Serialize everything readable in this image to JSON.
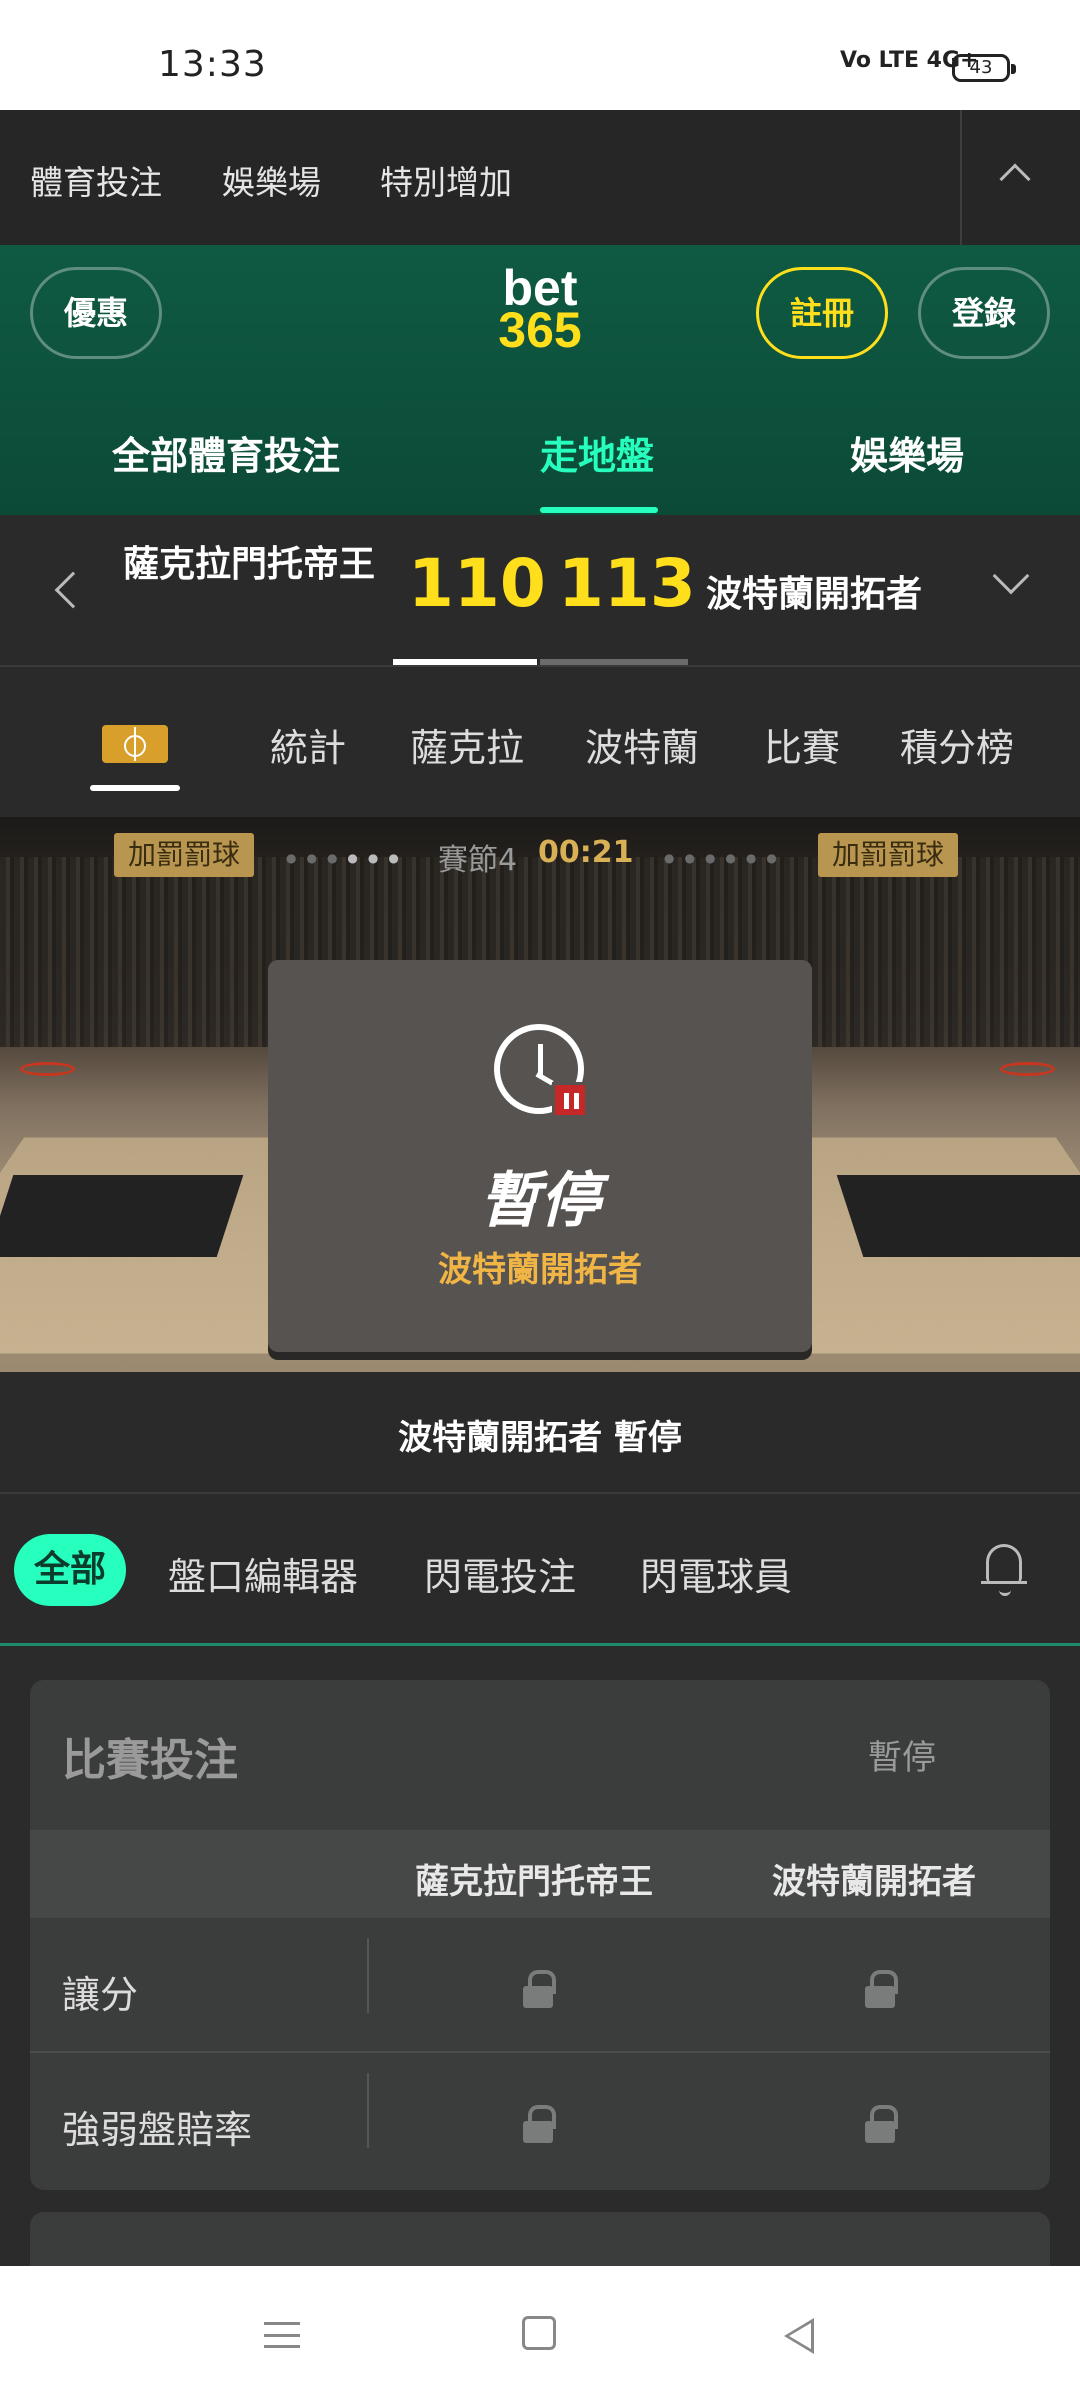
{
  "status_bar": {
    "time": "13:33",
    "signal": "Vo LTE 4G+",
    "battery": "43"
  },
  "top_nav": {
    "items": [
      "體育投注",
      "娛樂場",
      "特別增加"
    ]
  },
  "header": {
    "promo_button": "優惠",
    "logo_top": "bet",
    "logo_bottom": "365",
    "register_button": "註冊",
    "login_button": "登錄",
    "tabs": [
      "全部體育投注",
      "走地盤",
      "娛樂場"
    ],
    "active_tab": "走地盤",
    "accent_color": "#26ffbe",
    "brand_yellow": "#ffdf1b"
  },
  "scoreboard": {
    "home_team": "薩克拉門托帝王",
    "home_score": "110",
    "away_score": "113",
    "away_team": "波特蘭開拓者"
  },
  "sub_tabs": {
    "items": [
      "統計",
      "薩克拉",
      "波特蘭",
      "比賽",
      "積分榜"
    ]
  },
  "arena": {
    "bonus_left": "加罰罰球",
    "bonus_right": "加罰罰球",
    "period": "賽節4",
    "clock": "00:21",
    "pause_title": "暫停",
    "pause_team": "波特蘭開拓者"
  },
  "event_text": "波特蘭開拓者 暫停",
  "filters": {
    "all": "全部",
    "items": [
      "盤口編輯器",
      "閃電投注",
      "閃電球員"
    ]
  },
  "markets": {
    "title": "比賽投注",
    "status": "暫停",
    "col1": "薩克拉門托帝王",
    "col2": "波特蘭開拓者",
    "rows": [
      "讓分",
      "強弱盤賠率"
    ]
  }
}
